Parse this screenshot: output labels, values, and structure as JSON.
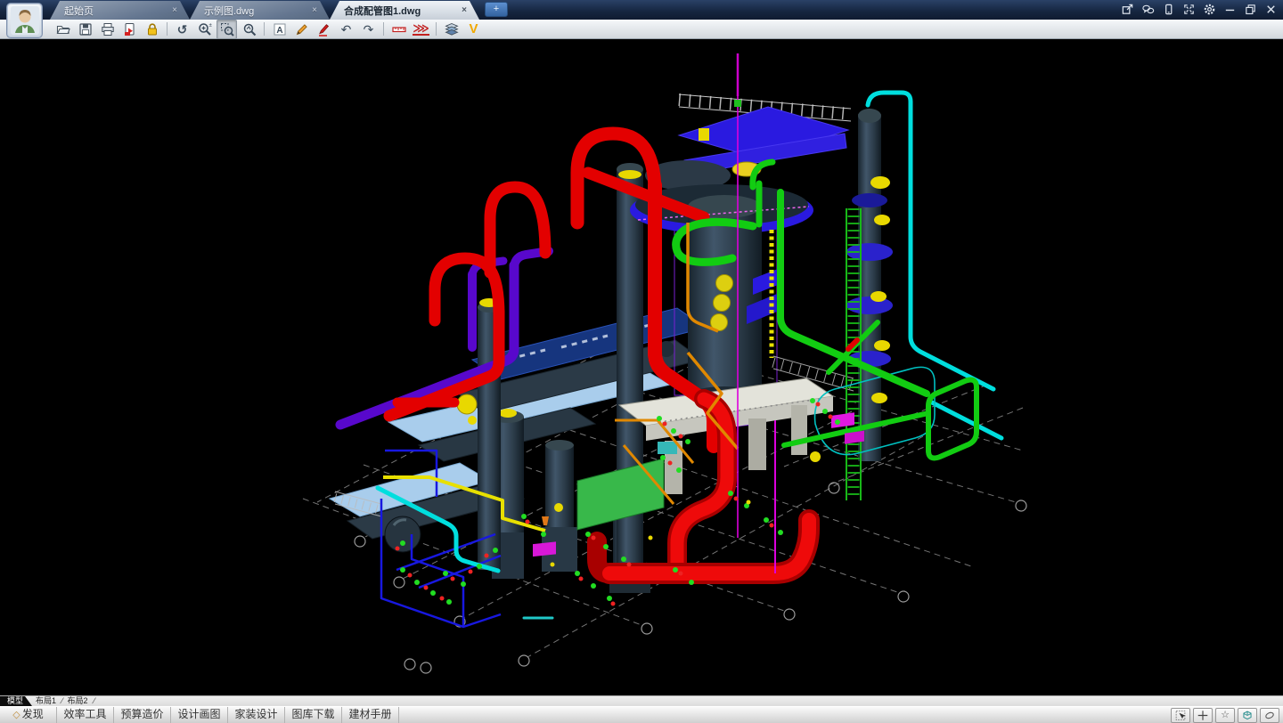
{
  "titlebar": {
    "tabs": [
      {
        "label": "起始页",
        "close": "×",
        "active": false
      },
      {
        "label": "示例图.dwg",
        "close": "×",
        "active": false
      },
      {
        "label": "合成配管图1.dwg",
        "close": "×",
        "active": true
      }
    ],
    "new_tab": "+",
    "window_controls": [
      "share-icon",
      "chat-icon",
      "mobile-icon",
      "fullscreen-icon",
      "settings-icon",
      "minimize-icon",
      "restore-icon",
      "close-icon"
    ]
  },
  "toolbar": {
    "icons": [
      {
        "name": "open-file"
      },
      {
        "name": "save"
      },
      {
        "name": "print"
      },
      {
        "name": "export-pdf"
      },
      {
        "name": "lock",
        "color": "#f0c020"
      },
      {
        "name": "orbit",
        "glyph": "↺"
      },
      {
        "name": "zoom-in-out"
      },
      {
        "name": "zoom-window",
        "pressed": true
      },
      {
        "name": "zoom-extents"
      },
      {
        "name": "text-annotate",
        "glyph": "A"
      },
      {
        "name": "pencil-markup"
      },
      {
        "name": "pen-markup"
      },
      {
        "name": "undo",
        "glyph": "↶"
      },
      {
        "name": "redo",
        "glyph": "↷"
      },
      {
        "name": "measure"
      },
      {
        "name": "fast-forward",
        "glyph": "⋙"
      },
      {
        "name": "layers"
      },
      {
        "name": "brand-v",
        "glyph": "V"
      }
    ]
  },
  "viewport": {
    "file": "合成配管图1.dwg",
    "description": "3D piping plant model on black model-space background",
    "background": "#000000",
    "palette": {
      "pipe_red": "#e30000",
      "pipe_green": "#12cc12",
      "pipe_cyan": "#00dede",
      "pipe_blue": "#1818e0",
      "deck_blue": "#2a1ae0",
      "pipe_purple": "#5808cc",
      "pipe_magenta": "#dd00dd",
      "pipe_yellow": "#e8d800",
      "pipe_orange": "#e08800",
      "steel_dark": "#2b3946",
      "platform_white": "#e3e3da",
      "panel_lightblue": "#a9cdec",
      "grid_gray": "#8a8a8a"
    }
  },
  "layout_bar": {
    "items": [
      {
        "label": "模型",
        "active": true
      },
      {
        "label": "布局1",
        "active": false
      },
      {
        "label": "布局2",
        "active": false
      }
    ],
    "separator": "/"
  },
  "menubar": {
    "items": [
      {
        "icon": "◇",
        "label": "发现"
      },
      {
        "label": "效率工具"
      },
      {
        "label": "预算造价"
      },
      {
        "label": "设计画图"
      },
      {
        "label": "家装设计"
      },
      {
        "label": "图库下载"
      },
      {
        "label": "建材手册"
      }
    ],
    "status_icons": [
      {
        "name": "select-cursor-icon"
      },
      {
        "name": "crosshair-icon"
      },
      {
        "name": "star-icon",
        "glyph": "☆"
      },
      {
        "name": "cube-3d-icon"
      },
      {
        "name": "lasso-icon"
      }
    ]
  }
}
